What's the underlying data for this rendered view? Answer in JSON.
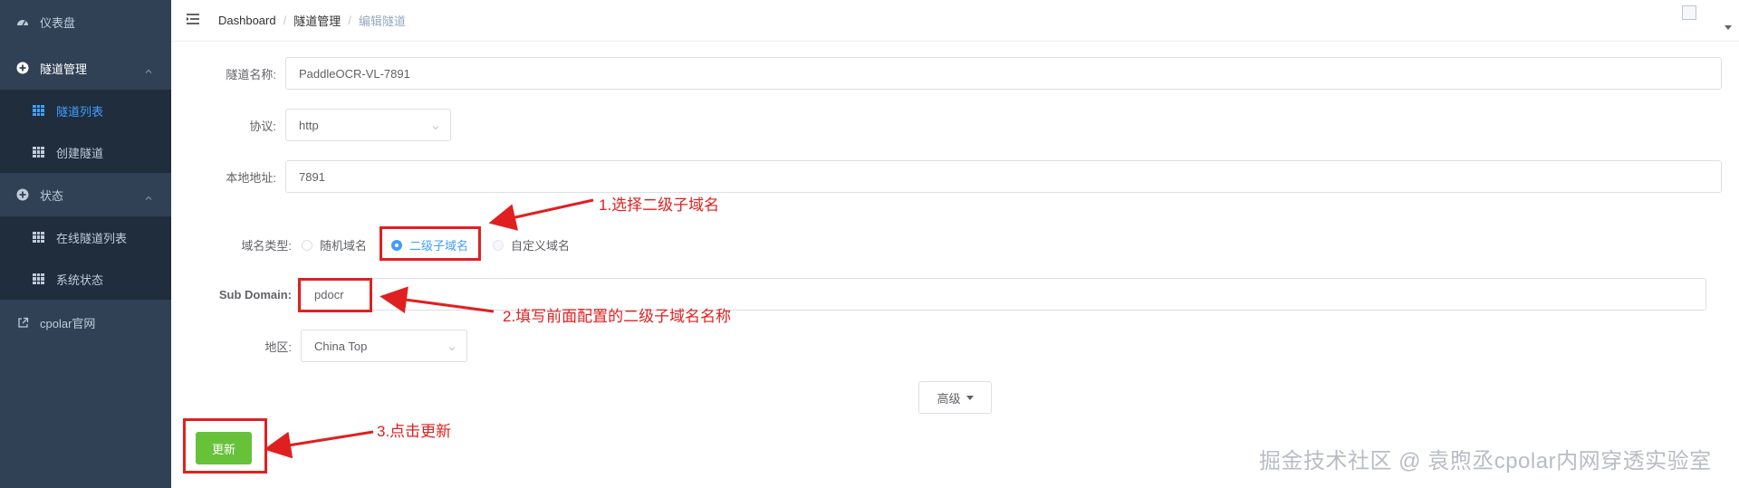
{
  "sidebar": {
    "dashboard": {
      "label": "仪表盘",
      "icon": "dashboard-icon"
    },
    "tunnel_mgmt": {
      "label": "隧道管理",
      "icon": "plus-circle-icon"
    },
    "tunnel_list": {
      "label": "隧道列表",
      "icon": "table-icon"
    },
    "create_tunnel": {
      "label": "创建隧道",
      "icon": "table-icon"
    },
    "status": {
      "label": "状态",
      "icon": "plus-circle-icon"
    },
    "online_tunnels": {
      "label": "在线隧道列表",
      "icon": "table-icon"
    },
    "system_status": {
      "label": "系统状态",
      "icon": "table-icon"
    },
    "cpolar_site": {
      "label": "cpolar官网",
      "icon": "external-link-icon"
    }
  },
  "breadcrumb": {
    "items": [
      "Dashboard",
      "隧道管理",
      "编辑隧道"
    ],
    "separator": "/"
  },
  "form": {
    "tunnel_name": {
      "label": "隧道名称:",
      "value": "PaddleOCR-VL-7891"
    },
    "protocol": {
      "label": "协议:",
      "value": "http"
    },
    "local_address": {
      "label": "本地地址:",
      "value": "7891"
    },
    "domain_type": {
      "label": "域名类型:",
      "options": [
        "随机域名",
        "二级子域名",
        "自定义域名"
      ],
      "selected": "二级子域名"
    },
    "sub_domain": {
      "label": "Sub Domain:",
      "value": "pdocr"
    },
    "region": {
      "label": "地区:",
      "value": "China Top"
    }
  },
  "buttons": {
    "advanced": "高级",
    "update": "更新"
  },
  "annotations": {
    "step1": "1.选择二级子域名",
    "step2": "2.填写前面配置的二级子域名名称",
    "step3": "3.点击更新"
  },
  "watermark": "掘金技术社区 @ 袁煦丞cpolar内网穿透实验室",
  "colors": {
    "sidebar_bg": "#304156",
    "submenu_bg": "#1f2d3d",
    "accent": "#409eff",
    "update_button": "#67c23a",
    "annotation": "#e02020"
  }
}
